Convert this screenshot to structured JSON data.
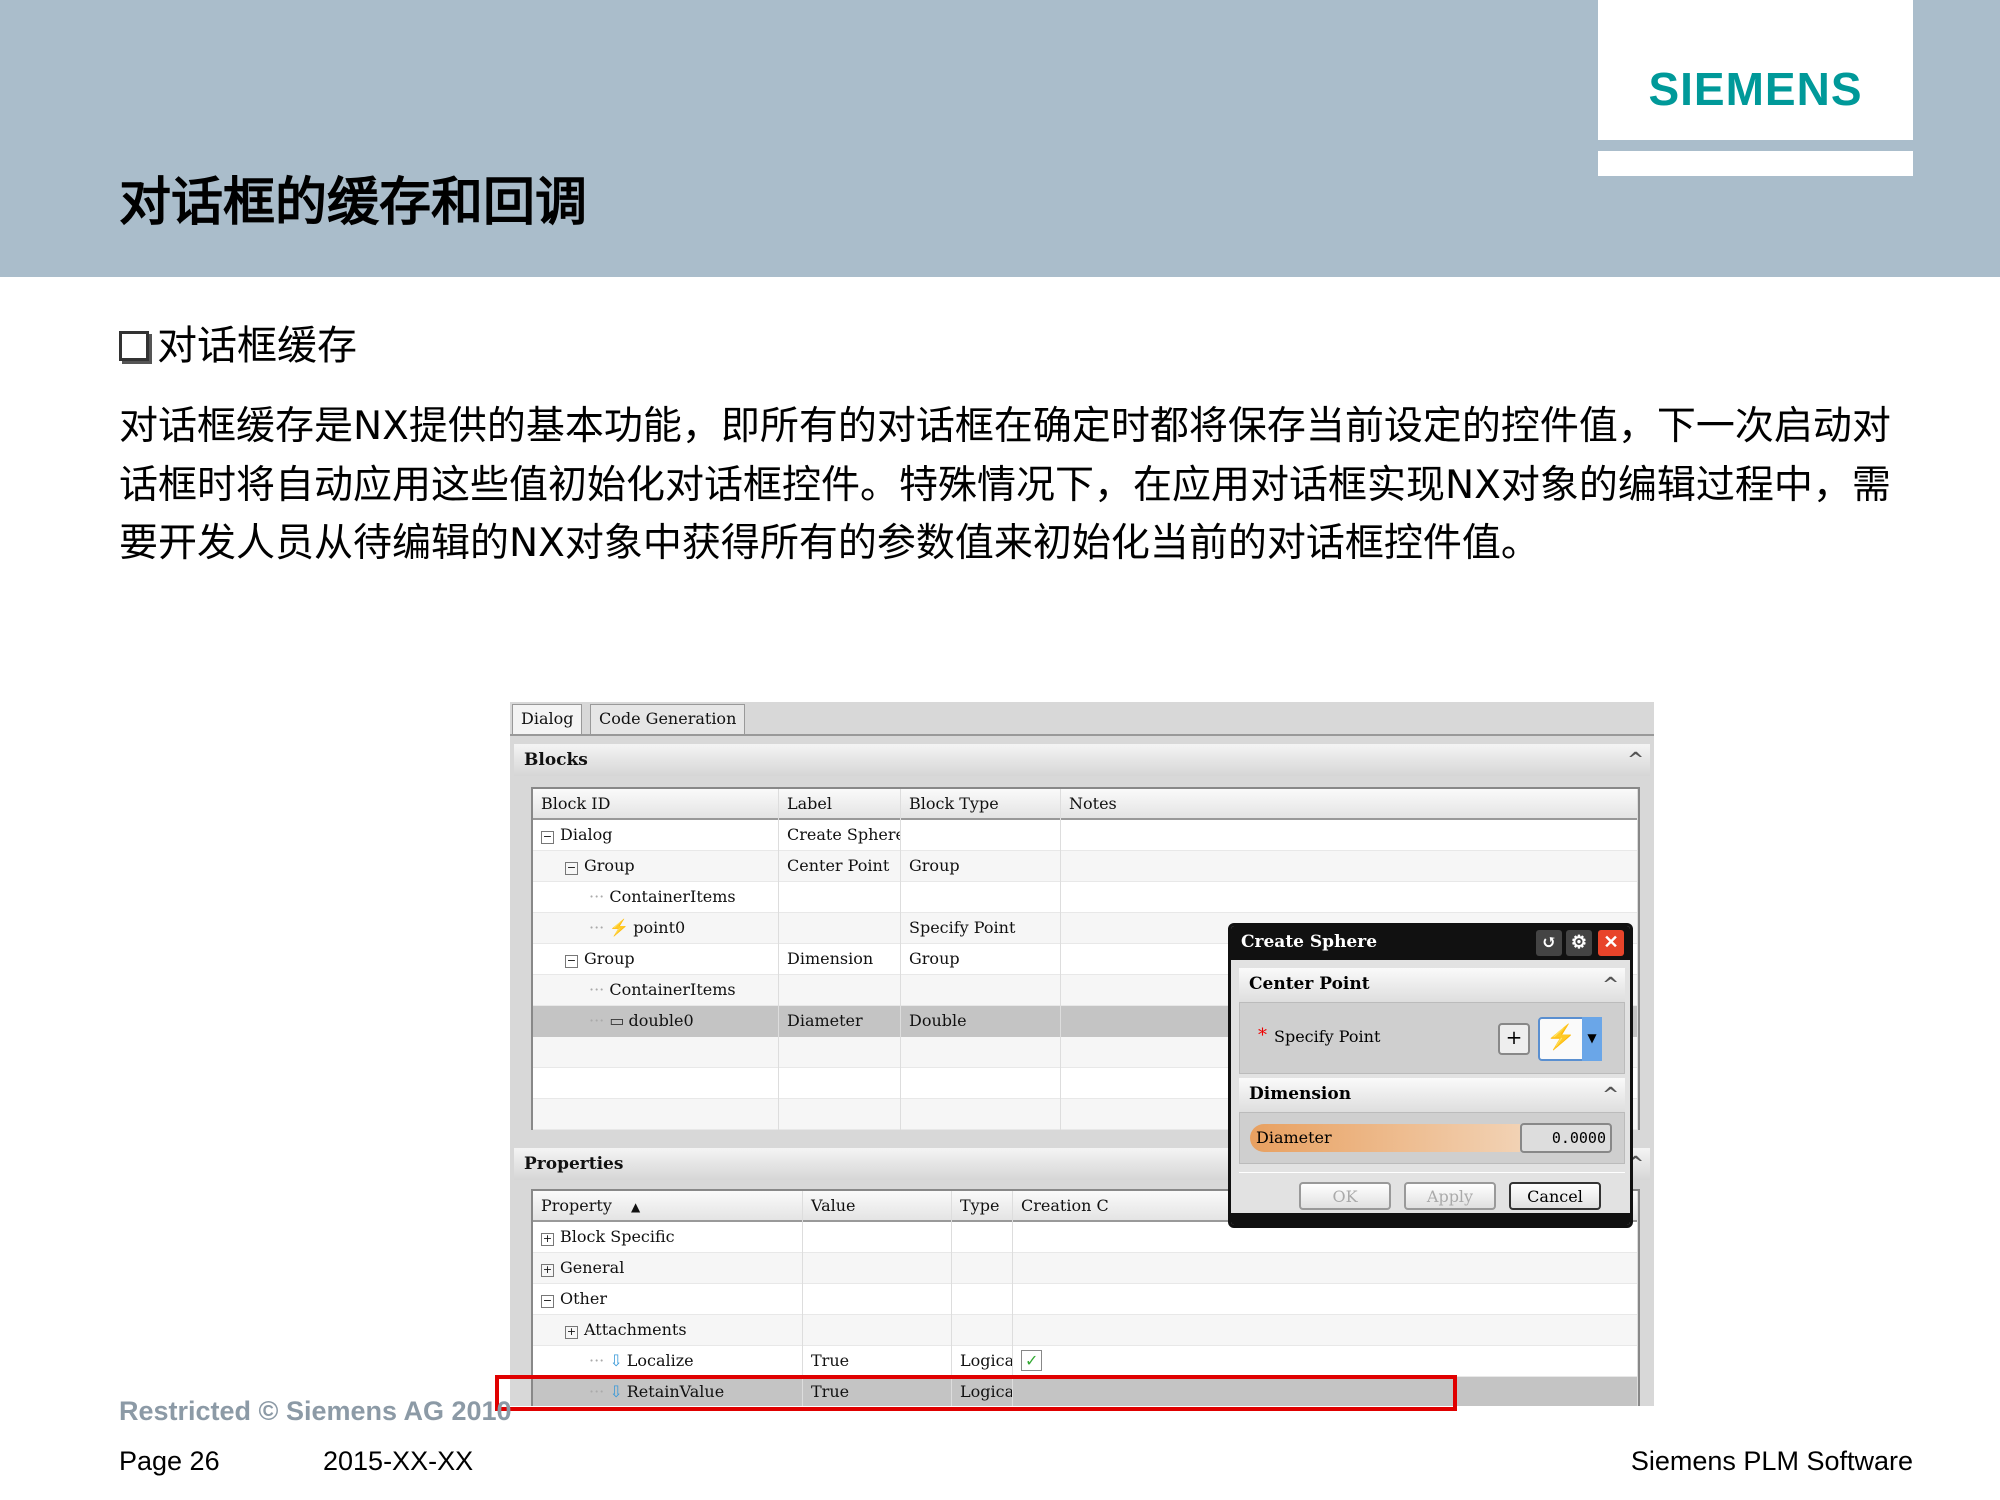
{
  "slide": {
    "title": "对话框的缓存和回调",
    "bullet": "对话框缓存",
    "paragraph": "对话框缓存是NX提供的基本功能，即所有的对话框在确定时都将保存当前设定的控件值，下一次启动对话框时将自动应用这些值初始化对话框控件。特殊情况下，在应用对话框实现NX对象的编辑过程中，需要开发人员从待编辑的NX对象中获得所有的参数值来初始化当前的对话框控件值。",
    "logo": "SIEMENS",
    "brand_color": "#009999",
    "header_color": "#aabdcb"
  },
  "footer": {
    "restricted": "Restricted © Siemens AG 2010",
    "page": "Page 26",
    "date": "2015-XX-XX",
    "company": "Siemens PLM Software"
  },
  "app": {
    "tabs": [
      "Dialog",
      "Code Generation"
    ],
    "blocks": {
      "title": "Blocks",
      "columns": [
        "Block ID",
        "Label",
        "Block Type",
        "Notes"
      ],
      "rows": [
        {
          "id": "Dialog",
          "label": "Create Sphere",
          "type": "",
          "toggle": "minus",
          "level": 0
        },
        {
          "id": "Group",
          "label": "Center Point",
          "type": "Group",
          "toggle": "minus",
          "level": 1
        },
        {
          "id": "ContainerItems",
          "label": "",
          "type": "",
          "level": 2
        },
        {
          "id": "point0",
          "label": "",
          "type": "Specify Point",
          "level": 2,
          "icon": "specify-point-icon"
        },
        {
          "id": "Group",
          "label": "Dimension",
          "type": "Group",
          "toggle": "minus",
          "level": 1
        },
        {
          "id": "ContainerItems",
          "label": "",
          "type": "",
          "level": 2
        },
        {
          "id": "double0",
          "label": "Diameter",
          "type": "Double",
          "level": 2,
          "icon": "double-icon",
          "selected": true
        }
      ]
    },
    "properties": {
      "title": "Properties",
      "columns": [
        "Property",
        "Value",
        "Type",
        "Creation C"
      ],
      "rows": [
        {
          "name": "Block Specific",
          "value": "",
          "type": "",
          "toggle": "plus",
          "level": 0
        },
        {
          "name": "General",
          "value": "",
          "type": "",
          "toggle": "plus",
          "level": 0
        },
        {
          "name": "Other",
          "value": "",
          "type": "",
          "toggle": "minus",
          "level": 0
        },
        {
          "name": "Attachments",
          "value": "",
          "type": "",
          "toggle": "plus",
          "level": 1
        },
        {
          "name": "Localize",
          "value": "True",
          "type": "Logical",
          "level": 2,
          "icon": "arrow-down-icon",
          "creation_icon": true
        },
        {
          "name": "RetainValue",
          "value": "True",
          "type": "Logical",
          "level": 2,
          "icon": "arrow-down-icon",
          "selected": true
        }
      ]
    }
  },
  "dialog": {
    "title": "Create Sphere",
    "group1": "Center Point",
    "specify_point": "Specify Point",
    "group2": "Dimension",
    "diameter_label": "Diameter",
    "diameter_value": "0.0000",
    "ok": "OK",
    "apply": "Apply",
    "cancel": "Cancel"
  }
}
